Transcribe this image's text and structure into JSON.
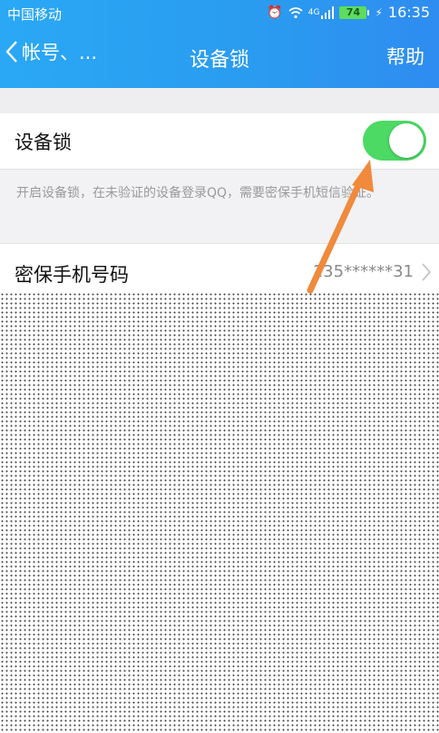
{
  "status_bar": {
    "carrier": "中国移动",
    "network": "4G",
    "battery": "74",
    "time": "16:35",
    "icons": [
      "alarm-icon",
      "wifi-icon",
      "signal-icon",
      "battery-icon",
      "charging-icon"
    ]
  },
  "nav": {
    "back_label": "帐号、...",
    "title": "设备锁",
    "help_label": "帮助"
  },
  "device_lock": {
    "label": "设备锁",
    "enabled": true,
    "hint": "开启设备锁，在未验证的设备登录QQ，需要密保手机短信验证。"
  },
  "security_phone": {
    "label": "密保手机号码",
    "value": "135******31"
  },
  "colors": {
    "accent": "#2a9bf0",
    "toggle_on": "#4cd964",
    "arrow": "#f08a3c"
  }
}
